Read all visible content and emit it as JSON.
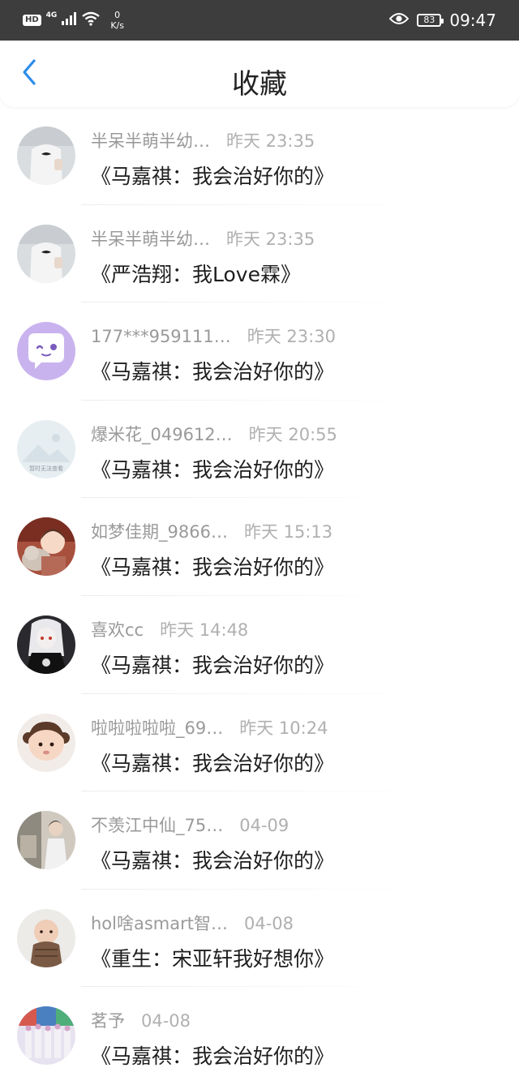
{
  "status_bar": {
    "hd_badge": "HD",
    "network_type": "4G",
    "speed_value": "0",
    "speed_unit": "K/s",
    "battery": "83",
    "time": "09:47"
  },
  "header": {
    "title": "收藏",
    "back_icon": "chevron-left-icon"
  },
  "colors": {
    "accent": "#2b8ce8",
    "status_bar_bg": "#3d3d3d",
    "meta_text": "#9a9a9a",
    "message_text": "#1e1e1e"
  },
  "items": [
    {
      "name": "半呆半萌半幼…",
      "time": "昨天 23:35",
      "message": "《马嘉祺：我会治好你的》",
      "avatar": "avatar-white-shirt"
    },
    {
      "name": "半呆半萌半幼…",
      "time": "昨天 23:35",
      "message": "《严浩翔：我Love霖》",
      "avatar": "avatar-white-shirt"
    },
    {
      "name": "177***959111…",
      "time": "昨天 23:30",
      "message": "《马嘉祺：我会治好你的》",
      "avatar": "avatar-purple-chat"
    },
    {
      "name": "爆米花_049612…",
      "time": "昨天 20:55",
      "message": "《马嘉祺：我会治好你的》",
      "avatar": "avatar-placeholder",
      "avatar_caption": "暂时无法查看"
    },
    {
      "name": "如梦佳期_9866…",
      "time": "昨天 15:13",
      "message": "《马嘉祺：我会治好你的》",
      "avatar": "avatar-girl-cat"
    },
    {
      "name": "喜欢cc",
      "time": "昨天 14:48",
      "message": "《马嘉祺：我会治好你的》",
      "avatar": "avatar-anime-dark"
    },
    {
      "name": "啦啦啦啦啦_69…",
      "time": "昨天 10:24",
      "message": "《马嘉祺：我会治好你的》",
      "avatar": "avatar-baby-girl"
    },
    {
      "name": "不羡江中仙_75…",
      "time": "04-09",
      "message": "《马嘉祺：我会治好你的》",
      "avatar": "avatar-person-room"
    },
    {
      "name": "hol啥asmart智…",
      "time": "04-08",
      "message": "《重生：宋亚轩我好想你》",
      "avatar": "avatar-baby-boy"
    },
    {
      "name": "茗予",
      "time": "04-08",
      "message": "《马嘉祺：我会治好你的》",
      "avatar": "avatar-group-stage"
    }
  ]
}
